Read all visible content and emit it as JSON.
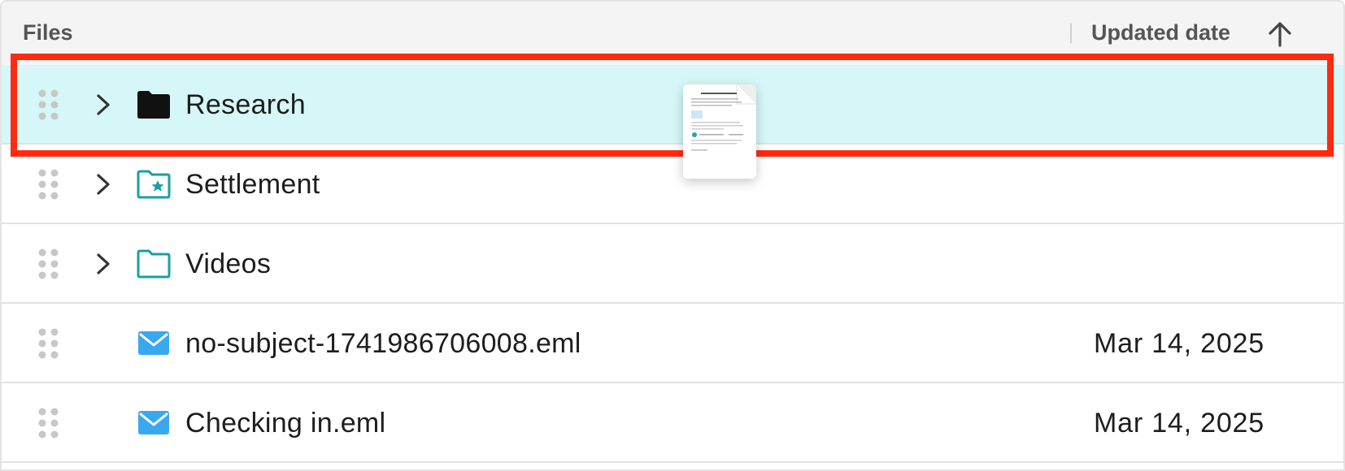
{
  "header": {
    "files_label": "Files",
    "date_label": "Updated date",
    "sort_icon": "arrow-up-icon"
  },
  "rows": [
    {
      "name": "Research",
      "date": "",
      "type": "folder",
      "icon": "folder-filled-icon",
      "expandable": true,
      "highlighted": true
    },
    {
      "name": "Settlement",
      "date": "",
      "type": "folder",
      "icon": "folder-star-icon",
      "expandable": true,
      "highlighted": false
    },
    {
      "name": "Videos",
      "date": "",
      "type": "folder",
      "icon": "folder-outline-icon",
      "expandable": true,
      "highlighted": false
    },
    {
      "name": "no-subject-1741986706008.eml",
      "date": "Mar 14, 2025",
      "type": "email",
      "icon": "mail-icon",
      "expandable": false,
      "highlighted": false
    },
    {
      "name": "Checking in.eml",
      "date": "Mar 14, 2025",
      "type": "email",
      "icon": "mail-icon",
      "expandable": false,
      "highlighted": false
    }
  ],
  "drag_preview": {
    "icon": "document-thumbnail-icon"
  },
  "colors": {
    "highlight_row": "#d6f7f8",
    "selection_border": "#ff2a0f",
    "folder_teal": "#1a9fa0",
    "mail_blue": "#3aa8f0",
    "header_bg": "#f4f4f4"
  }
}
